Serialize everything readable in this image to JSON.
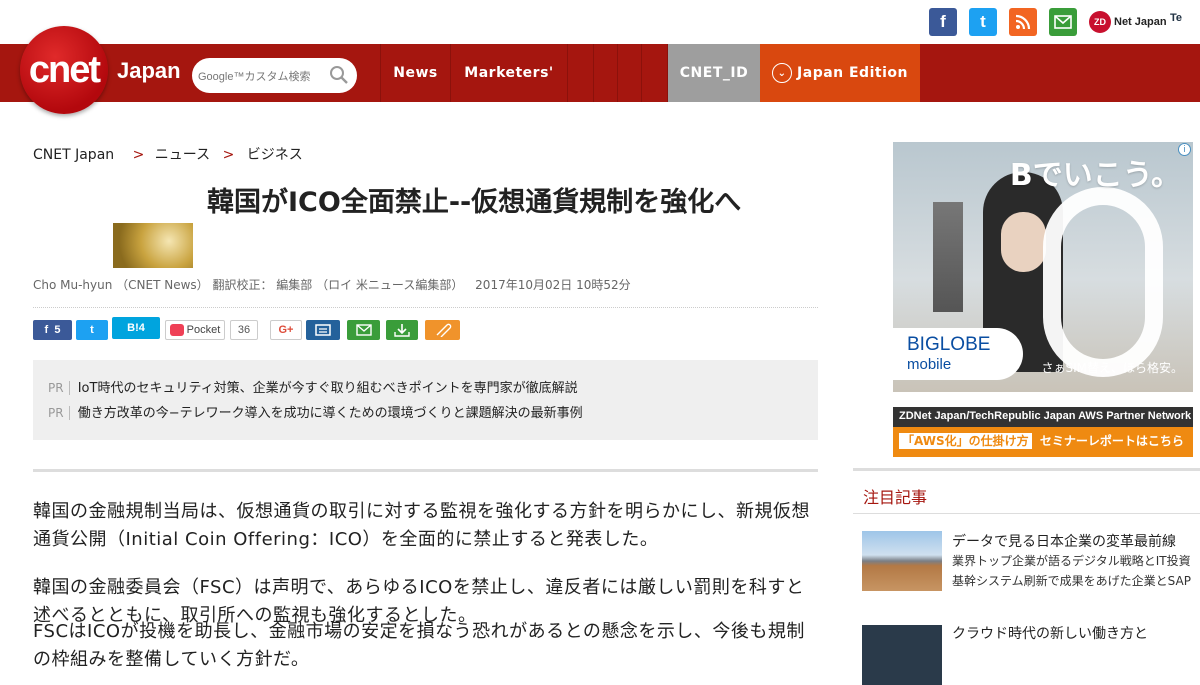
{
  "social": {
    "facebook_glyph": "f",
    "twitter_glyph": "t",
    "zdnet_label": "Net Japan",
    "zdnet_mark": "ZD",
    "techrepublic_label": "Te"
  },
  "nav": {
    "logo_text": "cnet",
    "logo_region": "Japan",
    "search_placeholder": "Google™カスタム検索",
    "items": [
      "News",
      "Marketers'"
    ],
    "cnet_id": "CNET_ID",
    "edition": "Japan Edition"
  },
  "breadcrumb": {
    "home": "CNET Japan",
    "sep": ">",
    "level1": "ニュース",
    "level2": "ビジネス"
  },
  "article": {
    "title": "韓国がICO全面禁止--仮想通貨規制を強化へ",
    "byline": "Cho Mu-hyun （CNET News） 翻訳校正： 編集部 （ロイ 米ニュース編集部）",
    "date": "2017年10月02日 10時52分",
    "paragraphs": [
      "韓国の金融規制当局は、仮想通貨の取引に対する監視を強化する方針を明らかにし、新規仮想通貨公開（Initial Coin Offering：ICO）を全面的に禁止すると発表した。",
      "韓国の金融委員会（FSC）は声明で、あらゆるICOを禁止し、違反者には厳しい罰則を科すと述べるとともに、取引所への監視も強化するとした。",
      "FSCはICOが投機を助長し、金融市場の安定を損なう恐れがあるとの懸念を示し、今後も規制の枠組みを整備していく方針だ。"
    ]
  },
  "share": {
    "facebook_count": "5",
    "twitter_glyph": "t",
    "hatena_label": "B!",
    "hatena_count": "4",
    "pocket_label": "Pocket",
    "pocket_count": "36",
    "gplus_label": "G+"
  },
  "pr": {
    "tag": "PR",
    "items": [
      "IoT時代のセキュリティ対策、企業が今すぐ取り組むべきポイントを専門家が徹底解説",
      "働き方改革の今−テレワーク導入を成功に導くための環境づくりと課題解決の最新事例"
    ]
  },
  "sidebar": {
    "ad": {
      "info_glyph": "i",
      "headline": "Bでいこう。",
      "brand_line1": "BIGLOBE",
      "brand_line2": "mobile",
      "tagline": "さぁSIM替え、ほら格安。"
    },
    "banner": {
      "top": "ZDNet Japan/TechRepublic Japan AWS Partner Network",
      "highlight": "「AWS化」の仕掛け方",
      "rest": "セミナーレポートはこちら"
    },
    "section_title": "注目記事",
    "items": [
      {
        "title": "データで見る日本企業の変革最前線",
        "sub1": "業界トップ企業が語るデジタル戦略とIT投資",
        "sub2": "基幹システム刷新で成果をあげた企業とSAP"
      },
      {
        "title": "クラウド時代の新しい働き方と",
        "sub1": "",
        "sub2": ""
      }
    ]
  },
  "colors": {
    "brand_red": "#a5160f",
    "edition_orange": "#d9480f",
    "cnet_id_gray": "#9e9e9e"
  }
}
